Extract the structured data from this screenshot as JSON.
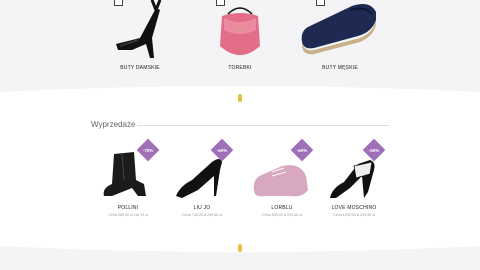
{
  "categories": [
    {
      "label": "BUTY DAMSKIE"
    },
    {
      "label": "TOREBKI"
    },
    {
      "label": "BUTY MĘSKIE"
    }
  ],
  "sale": {
    "title": "Wyprzedaże",
    "products": [
      {
        "brand": "POLLINI",
        "discount": "-70%",
        "price": "Cena 389,00 zł 116,70 zł"
      },
      {
        "brand": "LIU JO",
        "discount": "-60%",
        "price": "Cena 749,00 zł 299,60 zł"
      },
      {
        "brand": "LORBLU",
        "discount": "-60%",
        "price": "Cena 549,00 zł 219,60 zł"
      },
      {
        "brand": "LOVE MOSCHINO",
        "discount": "-50%",
        "price": "Cena 1239,00 zł 619,50 zł"
      }
    ]
  },
  "colors": {
    "accent": "#9f6fb7",
    "divider": "#e7c24a",
    "background": "#f4f4f6"
  }
}
